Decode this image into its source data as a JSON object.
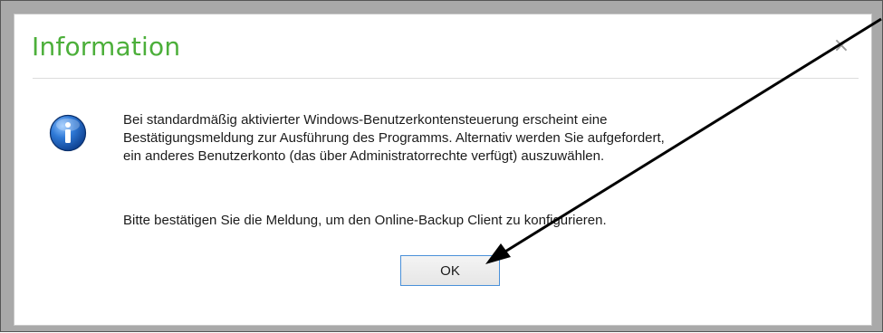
{
  "dialog": {
    "title": "Information",
    "close_glyph": "×",
    "icon": "info-icon",
    "message_lines": [
      "Bei standardmäßig aktivierter Windows-Benutzerkontensteuerung erscheint eine",
      "Bestätigungsmeldung zur Ausführung des Programms. Alternativ werden Sie aufgefordert,",
      "ein anderes Benutzerkonto (das über Administratorrechte verfügt) auszuwählen."
    ],
    "message_para2": "Bitte bestätigen Sie die Meldung, um den Online-Backup Client zu konfigurieren.",
    "ok_label": "OK"
  },
  "colors": {
    "title": "#4caf3a",
    "ok_border": "#4a90d9",
    "icon_blue": "#1f5fb8"
  },
  "annotation": {
    "type": "arrow",
    "target": "ok-button"
  }
}
